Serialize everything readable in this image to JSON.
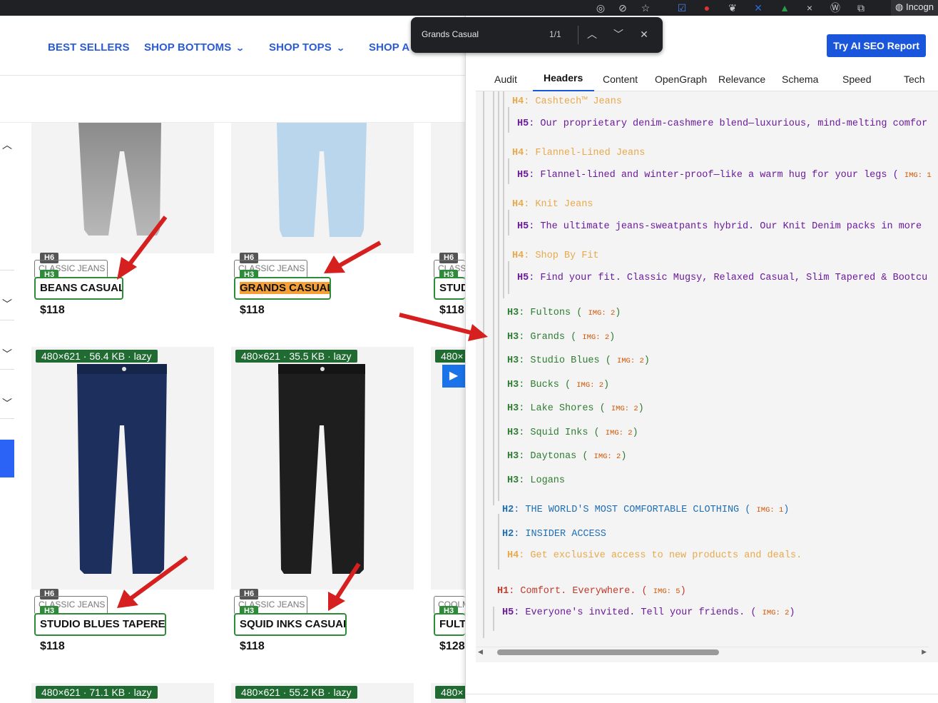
{
  "browser": {
    "incognito_label": "Incogn",
    "icons": [
      "lens-icon",
      "eye-off-icon",
      "star-icon",
      "extension-check-icon",
      "extension-red-icon",
      "extension-leaf-icon",
      "extension-x-icon",
      "extension-chart-icon",
      "extension-close-icon",
      "wordpress-icon",
      "puzzle-icon",
      "incognito-icon"
    ]
  },
  "find_bar": {
    "query": "Grands Casual",
    "count": "1/1"
  },
  "site": {
    "nav": [
      {
        "label": "BEST SELLERS",
        "has_dropdown": false
      },
      {
        "label": "SHOP BOTTOMS",
        "has_dropdown": true
      },
      {
        "label": "SHOP TOPS",
        "has_dropdown": true
      },
      {
        "label": "SHOP A",
        "has_dropdown": false
      }
    ],
    "products": [
      {
        "h6": "H6",
        "h3": "H3",
        "category": "CLASSIC JEANS",
        "name": "BEANS CASUAL",
        "price": "$118",
        "color": "gray"
      },
      {
        "h6": "H6",
        "h3": "H3",
        "category": "CLASSIC JEANS",
        "name": "GRANDS CASUAL",
        "price": "$118",
        "color": "light",
        "highlighted": true
      },
      {
        "h6": "H6",
        "h3": "H3",
        "category": "CLASS",
        "name": "STUD",
        "price": "$118",
        "color": "none"
      },
      {
        "size_badge": "480×621 · 56.4 KB · lazy",
        "h6": "H6",
        "h3": "H3",
        "category": "CLASSIC JEANS",
        "name": "STUDIO BLUES TAPERED",
        "price": "$118",
        "color": "navy"
      },
      {
        "size_badge": "480×621 · 35.5 KB · lazy",
        "h6": "H6",
        "h3": "H3",
        "category": "CLASSIC JEANS",
        "name": "SQUID INKS CASUAL",
        "price": "$118",
        "color": "black"
      },
      {
        "size_badge": "480×",
        "h6": "",
        "h3": "H3",
        "category": "COOLM",
        "name": "FULTO",
        "price": "$128",
        "color": "none"
      }
    ],
    "bottom_badges": [
      "480×621 · 71.1 KB · lazy",
      "480×621 · 55.2 KB · lazy",
      "480×"
    ]
  },
  "panel": {
    "seo_button": "Try AI SEO Report",
    "tabs": [
      "Audit",
      "Headers",
      "Content",
      "OpenGraph",
      "Relevance",
      "Schema",
      "Speed",
      "Tech"
    ],
    "active_tab": "Headers",
    "headers": [
      {
        "level": "H4",
        "text": "Cashtech™ Jeans",
        "img": ""
      },
      {
        "level": "H5",
        "text": "Our proprietary denim-cashmere blend—luxurious, mind-melting comfor",
        "img": ""
      },
      {
        "level": "H4",
        "text": "Flannel-Lined Jeans",
        "img": ""
      },
      {
        "level": "H5",
        "text": "Flannel-lined and winter-proof—like a warm hug for your legs",
        "img": "IMG: 1"
      },
      {
        "level": "H4",
        "text": "Knit Jeans",
        "img": ""
      },
      {
        "level": "H5",
        "text": "The ultimate jeans-sweatpants hybrid. Our Knit Denim packs in more",
        "img": ""
      },
      {
        "level": "H4",
        "text": "Shop By Fit",
        "img": ""
      },
      {
        "level": "H5",
        "text": "Find your fit. Classic Mugsy, Relaxed Casual, Slim Tapered & Bootcu",
        "img": ""
      },
      {
        "level": "H3",
        "text": "Fultons",
        "img": "IMG: 2"
      },
      {
        "level": "H3",
        "text": "Grands",
        "img": "IMG: 2"
      },
      {
        "level": "H3",
        "text": "Studio Blues",
        "img": "IMG: 2"
      },
      {
        "level": "H3",
        "text": "Bucks",
        "img": "IMG: 2"
      },
      {
        "level": "H3",
        "text": "Lake Shores",
        "img": "IMG: 2"
      },
      {
        "level": "H3",
        "text": "Squid Inks",
        "img": "IMG: 2"
      },
      {
        "level": "H3",
        "text": "Daytonas",
        "img": "IMG: 2"
      },
      {
        "level": "H3",
        "text": "Logans",
        "img": ""
      },
      {
        "level": "H2",
        "text": "THE WORLD'S MOST COMFORTABLE CLOTHING",
        "img": "IMG: 1"
      },
      {
        "level": "H2",
        "text": "INSIDER ACCESS",
        "img": ""
      },
      {
        "level": "H4",
        "text": "Get exclusive access to new products and deals.",
        "img": ""
      },
      {
        "level": "H1",
        "text": "Comfort. Everywhere.",
        "img": "IMG: 5"
      },
      {
        "level": "H5",
        "text": "Everyone's invited. Tell your friends.",
        "img": "IMG: 2"
      }
    ]
  },
  "colors": {
    "nav_blue": "#2a5bd7",
    "h3_green": "#2e8b3a",
    "highlight_orange": "#f6a03a",
    "annotation_red": "#d61f1f",
    "seo_button": "#1a56db"
  }
}
